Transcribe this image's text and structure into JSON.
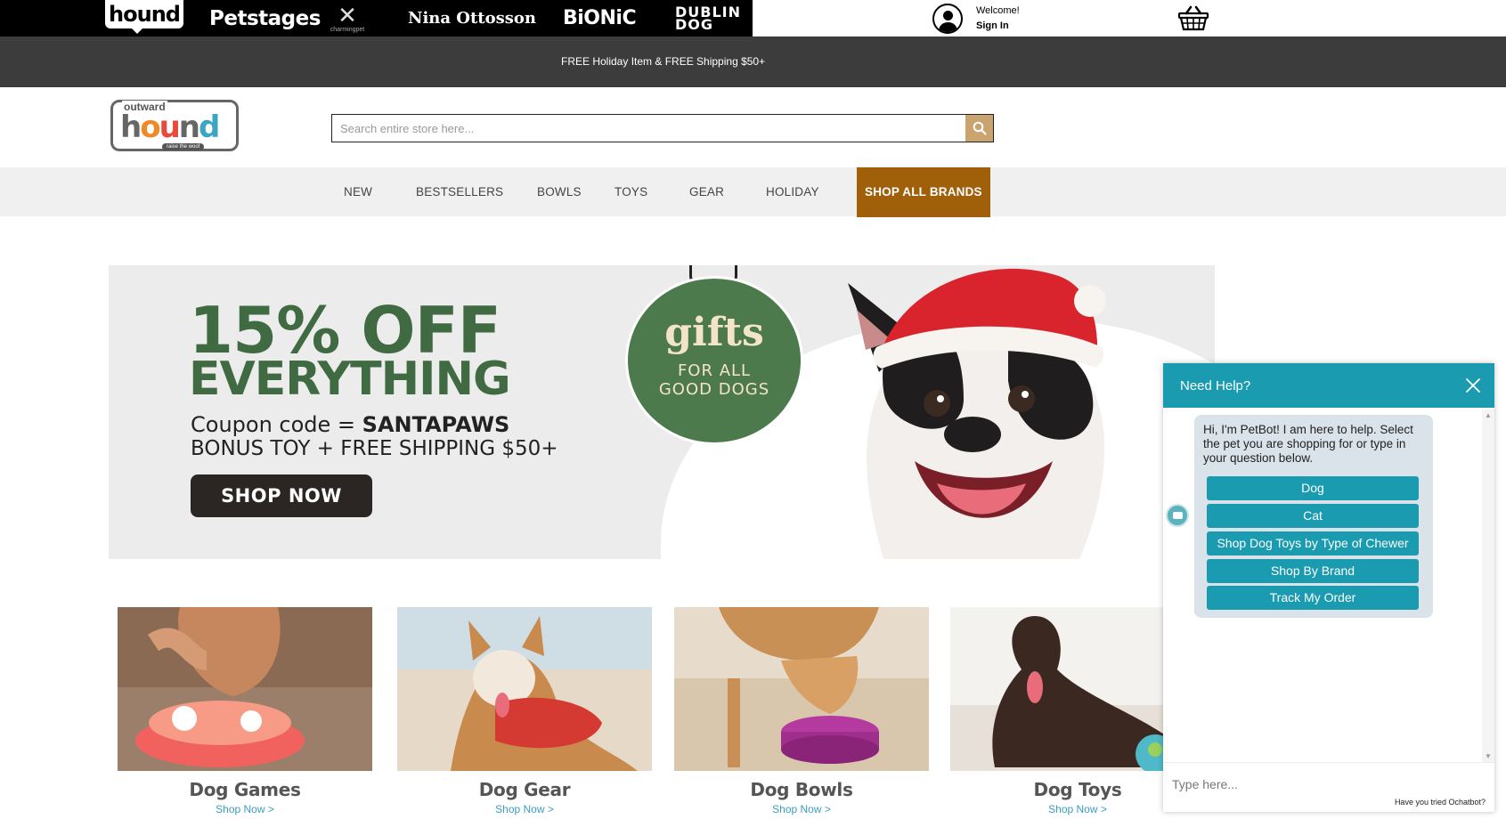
{
  "brands": {
    "hound": "hound",
    "petstages": "Petstages",
    "charming": "charmingpet",
    "nina": "Nina Ottosson",
    "bionic": "BiONiC",
    "dublin_1": "DUBLIN",
    "dublin_2": "DOG"
  },
  "account": {
    "welcome": "Welcome!",
    "signin": "Sign In"
  },
  "promo_text": "FREE Holiday Item & FREE Shipping $50+",
  "logo": {
    "top": "outward",
    "word": [
      "h",
      "o",
      "u",
      "n",
      "d"
    ],
    "tagline": "raise the woof"
  },
  "search": {
    "placeholder": "Search entire store here..."
  },
  "nav": [
    {
      "label": "NEW"
    },
    {
      "label": "BESTSELLERS"
    },
    {
      "label": "BOWLS"
    },
    {
      "label": "TOYS"
    },
    {
      "label": "GEAR"
    },
    {
      "label": "HOLIDAY"
    },
    {
      "label": "SHOP ALL BRANDS"
    }
  ],
  "hero": {
    "headline_1": "15% OFF",
    "headline_2": "EVERYTHING",
    "coupon_prefix": "Coupon code = ",
    "coupon_code": "SANTAPAWS",
    "bonus": "BONUS TOY + FREE SHIPPING $50+",
    "cta": "SHOP NOW",
    "ornament_title": "gifts",
    "ornament_sub_1": "FOR ALL",
    "ornament_sub_2": "GOOD DOGS"
  },
  "categories": [
    {
      "name": "Dog Games",
      "link": "Shop Now >"
    },
    {
      "name": "Dog Gear",
      "link": "Shop Now >"
    },
    {
      "name": "Dog Bowls",
      "link": "Shop Now >"
    },
    {
      "name": "Dog Toys",
      "link": "Shop Now >"
    }
  ],
  "chat": {
    "title": "Need Help?",
    "message": "Hi, I'm PetBot! I am here to help. Select the pet you are shopping for or type in your question below.",
    "options": [
      "Dog",
      "Cat",
      "Shop Dog Toys by Type of Chewer",
      "Shop By Brand",
      "Track My Order"
    ],
    "input_placeholder": "Type here...",
    "powered": "Have you tried Ochatbot?"
  },
  "colors": {
    "nav_highlight": "#a0600a",
    "chat_accent": "#1a9bb0",
    "hero_green": "#3f6a42",
    "link_blue": "#3a9ec0"
  }
}
